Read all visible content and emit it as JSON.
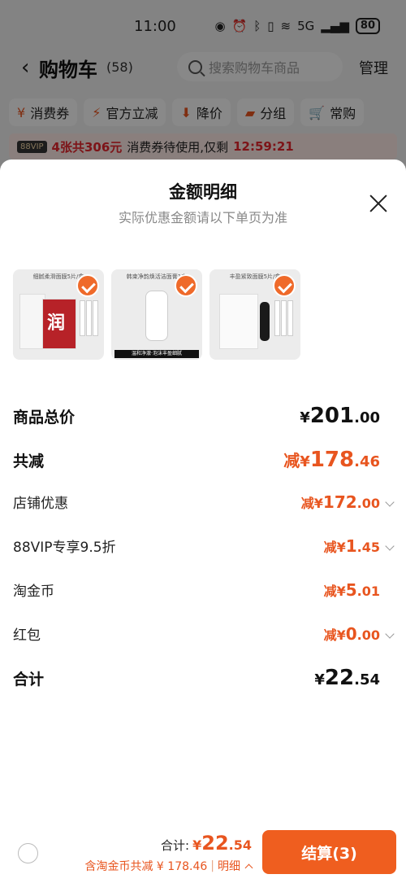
{
  "status": {
    "time": "11:00",
    "battery": "80",
    "signal": "5G"
  },
  "nav": {
    "title": "购物车",
    "count": "(58)",
    "search_placeholder": "搜索购物车商品",
    "manage": "管理"
  },
  "chips": [
    {
      "label": "消费券",
      "icon": "coupon-icon"
    },
    {
      "label": "官方立减",
      "icon": "flash-icon"
    },
    {
      "label": "降价",
      "icon": "price-down-icon"
    },
    {
      "label": "分组",
      "icon": "folder-icon"
    },
    {
      "label": "常购",
      "icon": "cart-icon"
    }
  ],
  "coupon_bar": {
    "vip": "88VIP",
    "highlight": "4张共306元",
    "text": "消费券待使用,仅剩",
    "countdown": "12:59:21"
  },
  "sheet": {
    "title": "金额明细",
    "subtitle": "实际优惠金额请以下单页为准",
    "products": [
      {
        "caption": "细腻柔滑面膜5片/盒"
      },
      {
        "caption": "韩束净韵焕活洁面膏1支",
        "band": "温和净澈·泡沫丰盈细腻"
      },
      {
        "caption": "丰盈紧致面膜5片/盒"
      }
    ],
    "rows": {
      "subtotal": {
        "label": "商品总价",
        "cur": "¥",
        "int": "201",
        "dec": ".00"
      },
      "discount": {
        "label": "共减",
        "pre": "减",
        "cur": "¥",
        "int": "178",
        "dec": ".46"
      },
      "shop": {
        "label": "店铺优惠",
        "pre": "减",
        "cur": "¥",
        "int": "172",
        "dec": ".00"
      },
      "vip": {
        "label": "88VIP专享9.5折",
        "pre": "减",
        "cur": "¥",
        "int": "1",
        "dec": ".45"
      },
      "coins": {
        "label": "淘金币",
        "pre": "减",
        "cur": "¥",
        "int": "5",
        "dec": ".01"
      },
      "redpacket": {
        "label": "红包",
        "pre": "减",
        "cur": "¥",
        "int": "0",
        "dec": ".00"
      },
      "total": {
        "label": "合计",
        "cur": "¥",
        "int": "22",
        "dec": ".54"
      }
    }
  },
  "bottom": {
    "total_label": "合计:",
    "total_cur": "¥",
    "total_int": "22",
    "total_dec": ".54",
    "sub_text": "含淘金币共减 ¥ 178.46",
    "detail": "明细",
    "checkout": "结算(3)"
  },
  "colors": {
    "accent": "#ef5e1f",
    "price": "#e8551f"
  }
}
